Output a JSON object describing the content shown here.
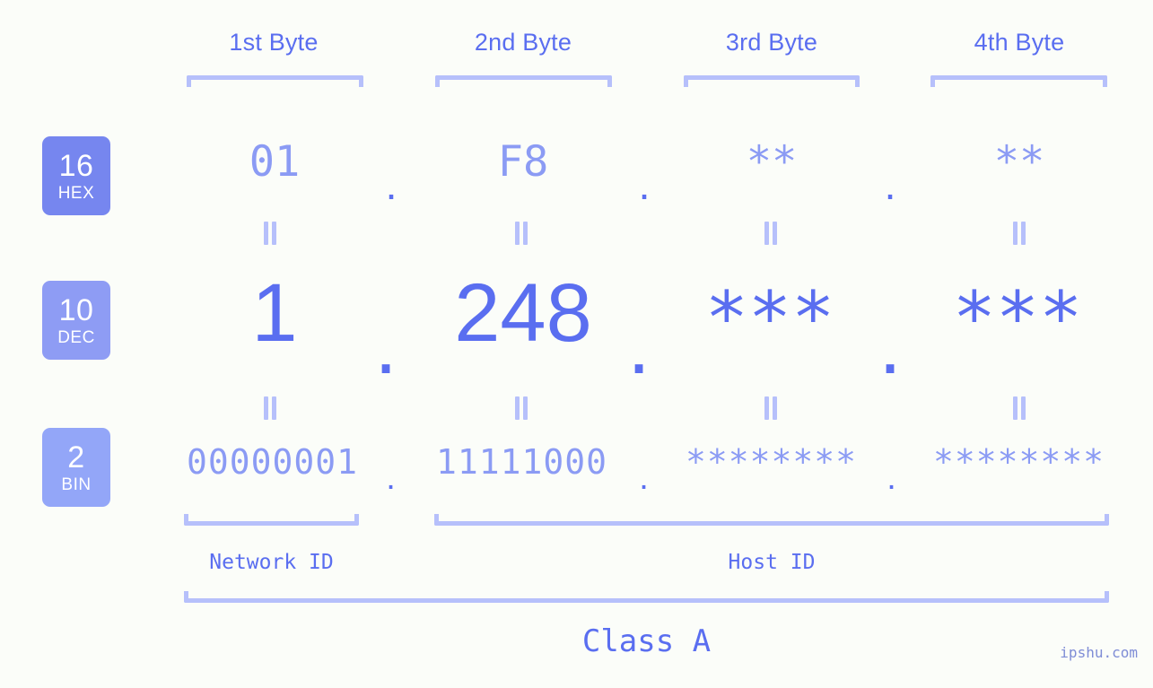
{
  "meta": {
    "background": "#fbfdf9",
    "accent_strong": "#5a6ef0",
    "accent_mid": "#8b9bf4",
    "accent_light": "#b6c0fb",
    "watermark": "ipshu.com"
  },
  "columns": [
    {
      "heading": "1st Byte"
    },
    {
      "heading": "2nd Byte"
    },
    {
      "heading": "3rd Byte"
    },
    {
      "heading": "4th Byte"
    }
  ],
  "separator": ".",
  "rows": [
    {
      "base_number": "16",
      "base_abbr": "HEX",
      "badge_color": "#7686ef",
      "values": [
        "01",
        "F8",
        "**",
        "**"
      ]
    },
    {
      "base_number": "10",
      "base_abbr": "DEC",
      "badge_color": "#8e9cf4",
      "values": [
        "1",
        "248",
        "***",
        "***"
      ]
    },
    {
      "base_number": "2",
      "base_abbr": "BIN",
      "badge_color": "#93a6f8",
      "values": [
        "00000001",
        "11111000",
        "********",
        "********"
      ]
    }
  ],
  "equals_symbol": "=",
  "segments": {
    "network": "Network ID",
    "host": "Host ID"
  },
  "class_label": "Class A"
}
